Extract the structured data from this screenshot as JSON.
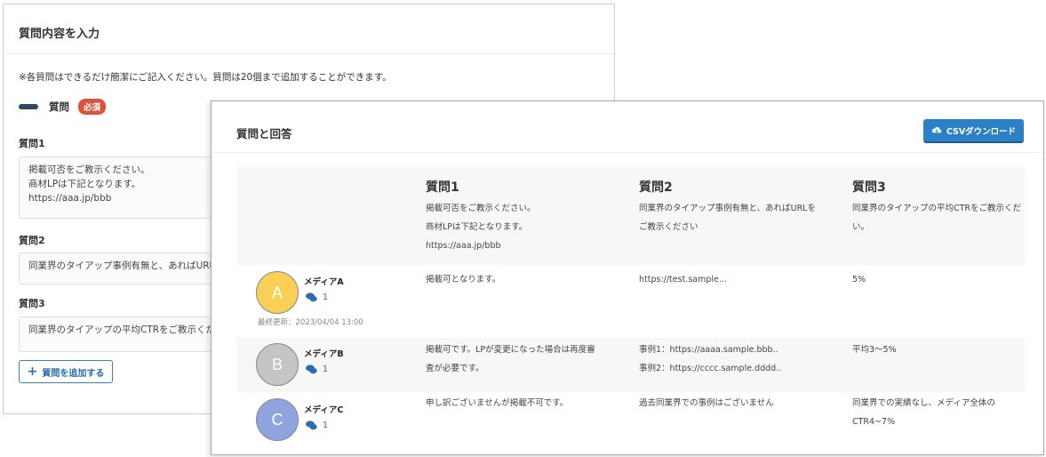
{
  "back": {
    "title": "質問内容を入力",
    "note": "※各質問はできるだけ簡潔にご記入ください。質問は20個まで追加することができます。",
    "section_title": "質問",
    "required": "必須",
    "questions": [
      {
        "label": "質問1",
        "value": "掲載可否をご教示ください。\n商材LPは下記となります。\nhttps://aaa.jp/bbb"
      },
      {
        "label": "質問2",
        "value": "同業界のタイアップ事例有無と、あればURLを"
      },
      {
        "label": "質問3",
        "value": "同業界のタイアップの平均CTRをご教示くださ"
      }
    ],
    "add_button": "質問を追加する"
  },
  "front": {
    "title": "質問と回答",
    "csv_button": "CSVダウンロード",
    "headers": [
      {
        "title": "質問1",
        "text": "掲載可否をご教示ください。\n商材LPは下記となります。\nhttps://aaa.jp/bbb"
      },
      {
        "title": "質問2",
        "text": "同業界のタイアップ事例有無と、あればURLを\nご教示ください"
      },
      {
        "title": "質問3",
        "text": "同業界のタイアップの平均CTRをご教示くだ\nい。"
      }
    ],
    "rows": [
      {
        "avatar": "A",
        "avatar_color": "#f9cf55",
        "name": "メディアA",
        "comments": "1",
        "updated": "最終更新：2023/04/04 13:00",
        "answers": [
          "掲載可となります。",
          "https://test.sample...",
          "5%"
        ]
      },
      {
        "avatar": "B",
        "avatar_color": "#c5c5c5",
        "name": "メディアB",
        "comments": "1",
        "updated": "",
        "answers": [
          "掲載可です。LPが変更になった場合は再度審\n査が必要です。",
          "事例1：https://aaaa.sample.bbb..\n事例2：https://cccc.sample.dddd..",
          "平均3～5%"
        ]
      },
      {
        "avatar": "C",
        "avatar_color": "#8ea6dd",
        "name": "メディアC",
        "comments": "1",
        "updated": "",
        "answers": [
          "申し訳ございませんが掲載不可です。",
          "過去同業界での事例はございません",
          "同業界での実績なし、メディア全体の\nCTR4~7%"
        ]
      }
    ]
  },
  "icons": {
    "cloud": "cloud-download-icon",
    "comment": "comments-icon",
    "plus": "plus-icon"
  },
  "colors": {
    "primary": "#2c80c5",
    "required": "#e0513b",
    "pill": "#2f4a63"
  }
}
